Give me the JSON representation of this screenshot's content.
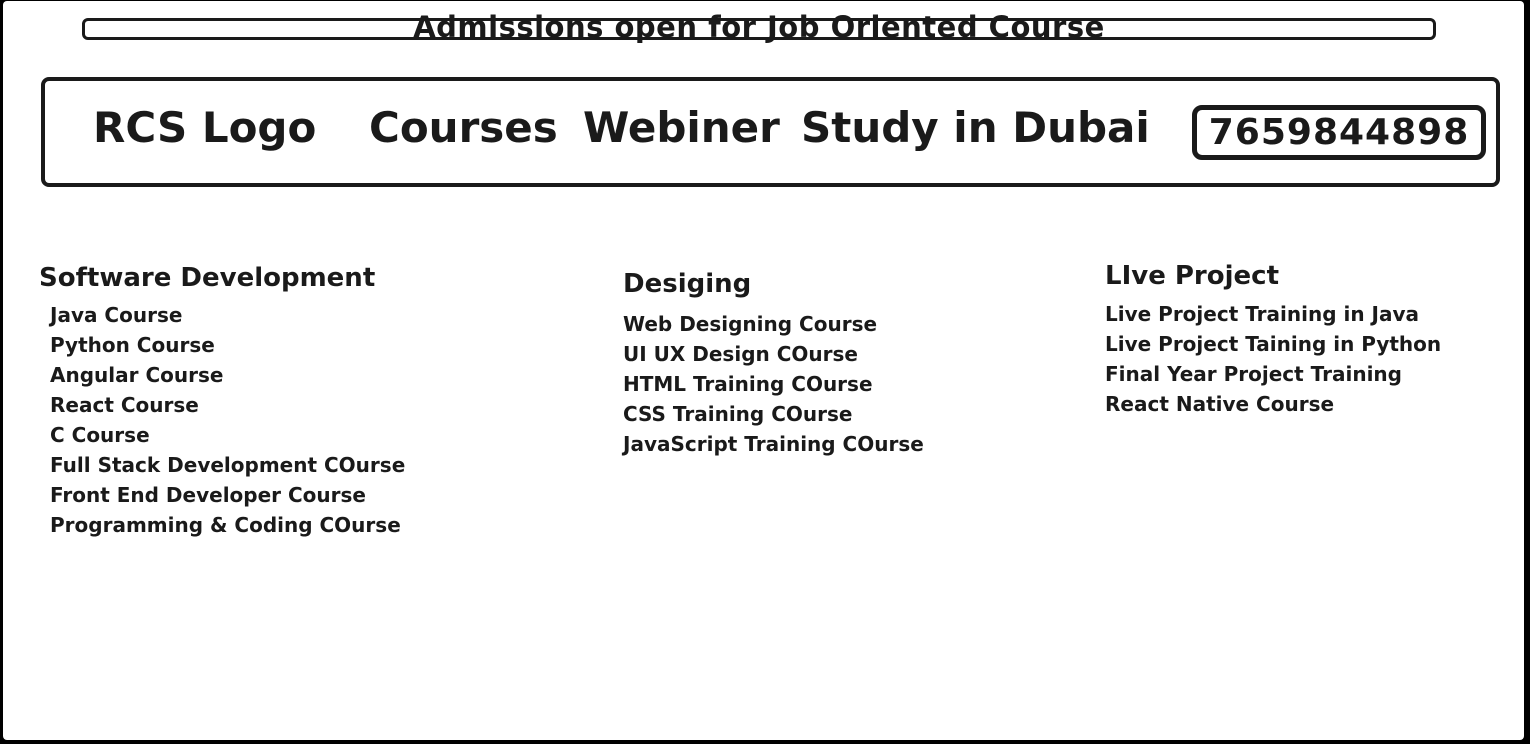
{
  "banner": {
    "text": "Admissions open for Job Oriented Course"
  },
  "navbar": {
    "logo": "RCS Logo",
    "links": [
      "Courses",
      "Webiner",
      "Study in Dubai"
    ],
    "phone": "7659844898"
  },
  "columns": [
    {
      "heading": "Software Development",
      "items": [
        "Java Course",
        "Python Course",
        "Angular Course",
        "React Course",
        "C Course",
        "Full Stack Development COurse",
        "Front End Developer Course",
        "Programming & Coding COurse"
      ]
    },
    {
      "heading": "Desiging",
      "items": [
        "Web Designing Course",
        "UI UX Design COurse",
        "HTML Training COurse",
        "CSS Training COurse",
        "JavaScript Training COurse"
      ]
    },
    {
      "heading": "LIve Project",
      "items": [
        "Live Project Training in Java",
        "Live Project Taining in Python",
        "Final Year Project Training",
        "React Native Course"
      ]
    }
  ],
  "colors": {
    "outer_background": "#000000",
    "page_background": "#ffffff",
    "ink": "#1a1a1a"
  }
}
